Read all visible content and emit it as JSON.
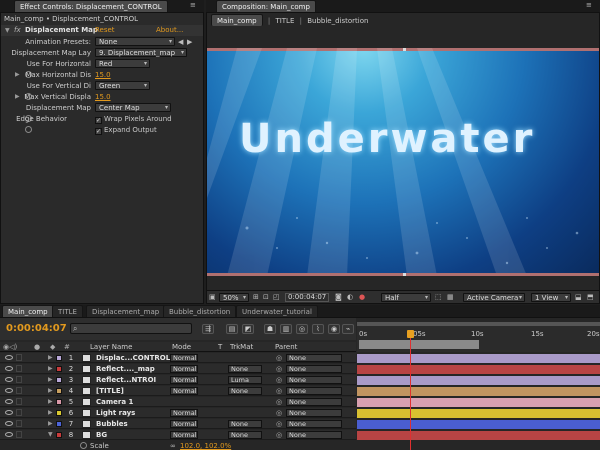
{
  "effect_controls": {
    "tab_label": "Effect Controls: Displacement_CONTROL",
    "breadcrumb": "Main_comp • Displacement_CONTROL",
    "effect_name": "Displacement Map",
    "reset": "Reset",
    "about": "About...",
    "rows": [
      {
        "label": "Animation Presets:",
        "value": "None"
      },
      {
        "label": "Displacement Map Lay",
        "value": "9. Displacement_map"
      },
      {
        "label": "Use For Horizontal",
        "value": "Red"
      },
      {
        "label": "Max Horizontal Dis",
        "value": "15.0"
      },
      {
        "label": "Use For Vertical Di",
        "value": "Green"
      },
      {
        "label": "Max Vertical Displa",
        "value": "15.0"
      },
      {
        "label": "Displacement Map",
        "value": "Center Map"
      },
      {
        "label": "Edge Behavior",
        "value": "Wrap Pixels Around"
      },
      {
        "label": "",
        "value": "Expand Output"
      }
    ]
  },
  "composition": {
    "tab_label": "Composition: Main_comp",
    "breadcrumbs": [
      "Main_comp",
      "TITLE",
      "Bubble_distortion"
    ],
    "title_text": "Underwater",
    "zoom": "50%",
    "timecode": "0:00:04:07",
    "resolution": "Half",
    "camera": "Active Camera",
    "view": "1 View"
  },
  "timeline": {
    "tabs": [
      "Main_comp",
      "TITLE",
      "Displacement_map",
      "Bubble_distortion",
      "Underwater_tutorial"
    ],
    "timecode": "0:00:04:07",
    "search_placeholder": "",
    "headers": {
      "layer_name": "Layer Name",
      "mode": "Mode",
      "t": "T",
      "trkmat": "TrkMat",
      "parent": "Parent"
    },
    "ruler": [
      "0s",
      "05s",
      "10s",
      "15s",
      "20s"
    ],
    "playhead_fraction": 0.208,
    "layers": [
      {
        "num": "1",
        "name": "Displac...CONTROL",
        "mode": "Normal",
        "trkmat": "",
        "parent": "None",
        "color": "#b9a8d8",
        "bar": "#a99ac8"
      },
      {
        "num": "2",
        "name": "Reflect...._map",
        "mode": "Normal",
        "trkmat": "None",
        "parent": "None",
        "color": "#c83c3c",
        "bar": "#b84444"
      },
      {
        "num": "3",
        "name": "Reflect...NTROI",
        "mode": "Normal",
        "trkmat": "Luma",
        "parent": "None",
        "color": "#b9a8d8",
        "bar": "#a99ac8"
      },
      {
        "num": "4",
        "name": "[TITLE]",
        "mode": "Normal",
        "trkmat": "None",
        "parent": "None",
        "color": "#c8a060",
        "bar": "#c09460"
      },
      {
        "num": "5",
        "name": "Camera 1",
        "mode": "",
        "trkmat": "",
        "parent": "None",
        "color": "#d898a8",
        "bar": "#d8a0b0"
      },
      {
        "num": "6",
        "name": "Light rays",
        "mode": "Normal",
        "trkmat": "",
        "parent": "None",
        "color": "#d8c830",
        "bar": "#d8c030"
      },
      {
        "num": "7",
        "name": "Bubbles",
        "mode": "Normal",
        "trkmat": "None",
        "parent": "None",
        "color": "#4c64d8",
        "bar": "#4a5ed0"
      },
      {
        "num": "8",
        "name": "BG",
        "mode": "Normal",
        "trkmat": "None",
        "parent": "None",
        "color": "#c83c3c",
        "bar": "#b84444"
      }
    ],
    "scale_label": "Scale",
    "scale_value": "102.0, 102.0%"
  }
}
